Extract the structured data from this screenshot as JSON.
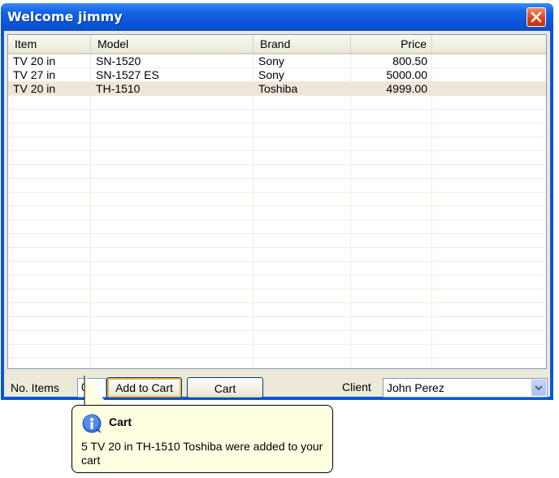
{
  "window": {
    "title": "Welcome jimmy"
  },
  "table": {
    "columns": [
      "Item",
      "Model",
      "Brand",
      "Price"
    ],
    "rows": [
      {
        "item": "TV 20 in",
        "model": "SN-1520",
        "brand": "Sony",
        "price": "800.50",
        "selected": false
      },
      {
        "item": "TV 27 in",
        "model": "SN-1527 ES",
        "brand": "Sony",
        "price": "5000.00",
        "selected": false
      },
      {
        "item": "TV 20 in",
        "model": "TH-1510",
        "brand": "Toshiba",
        "price": "4999.00",
        "selected": true
      }
    ]
  },
  "footer": {
    "items_label": "No. Items",
    "items_value": "0",
    "add_to_cart_label": "Add to Cart",
    "cart_label": "Cart",
    "client_label": "Client",
    "client_value": "John Perez"
  },
  "tooltip": {
    "icon": "info-icon",
    "title": "Cart",
    "message": "5 TV 20 in TH-1510 Toshiba were added to your cart"
  },
  "colors": {
    "titlebar": "#0a55d8",
    "selected_row": "#f0e5d9",
    "tooltip_bg": "#ffffe1"
  }
}
